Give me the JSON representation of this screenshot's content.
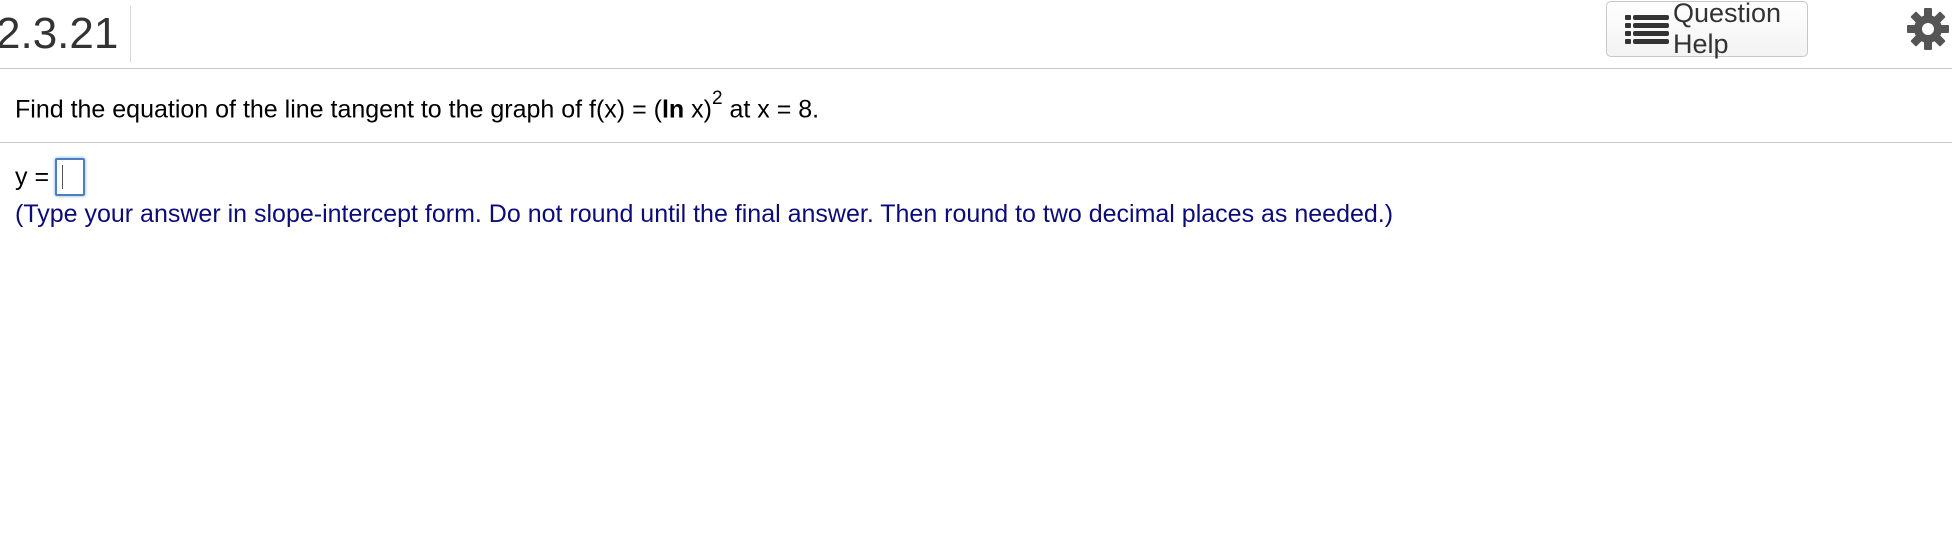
{
  "header": {
    "question_number": "2.3.21",
    "help_button_label": "Question Help"
  },
  "question": {
    "prefix": "Find the equation of the line tangent to the graph of f(x) = (",
    "bold_ln": "ln",
    "mid": " x)",
    "exponent": "2",
    "suffix": " at x = 8."
  },
  "answer": {
    "label": "y =",
    "value": ""
  },
  "hint": "(Type your answer in slope-intercept form. Do not round until the final answer. Then round to two decimal places as needed.)",
  "icons": {
    "help": "list-icon",
    "settings": "gear-icon"
  }
}
